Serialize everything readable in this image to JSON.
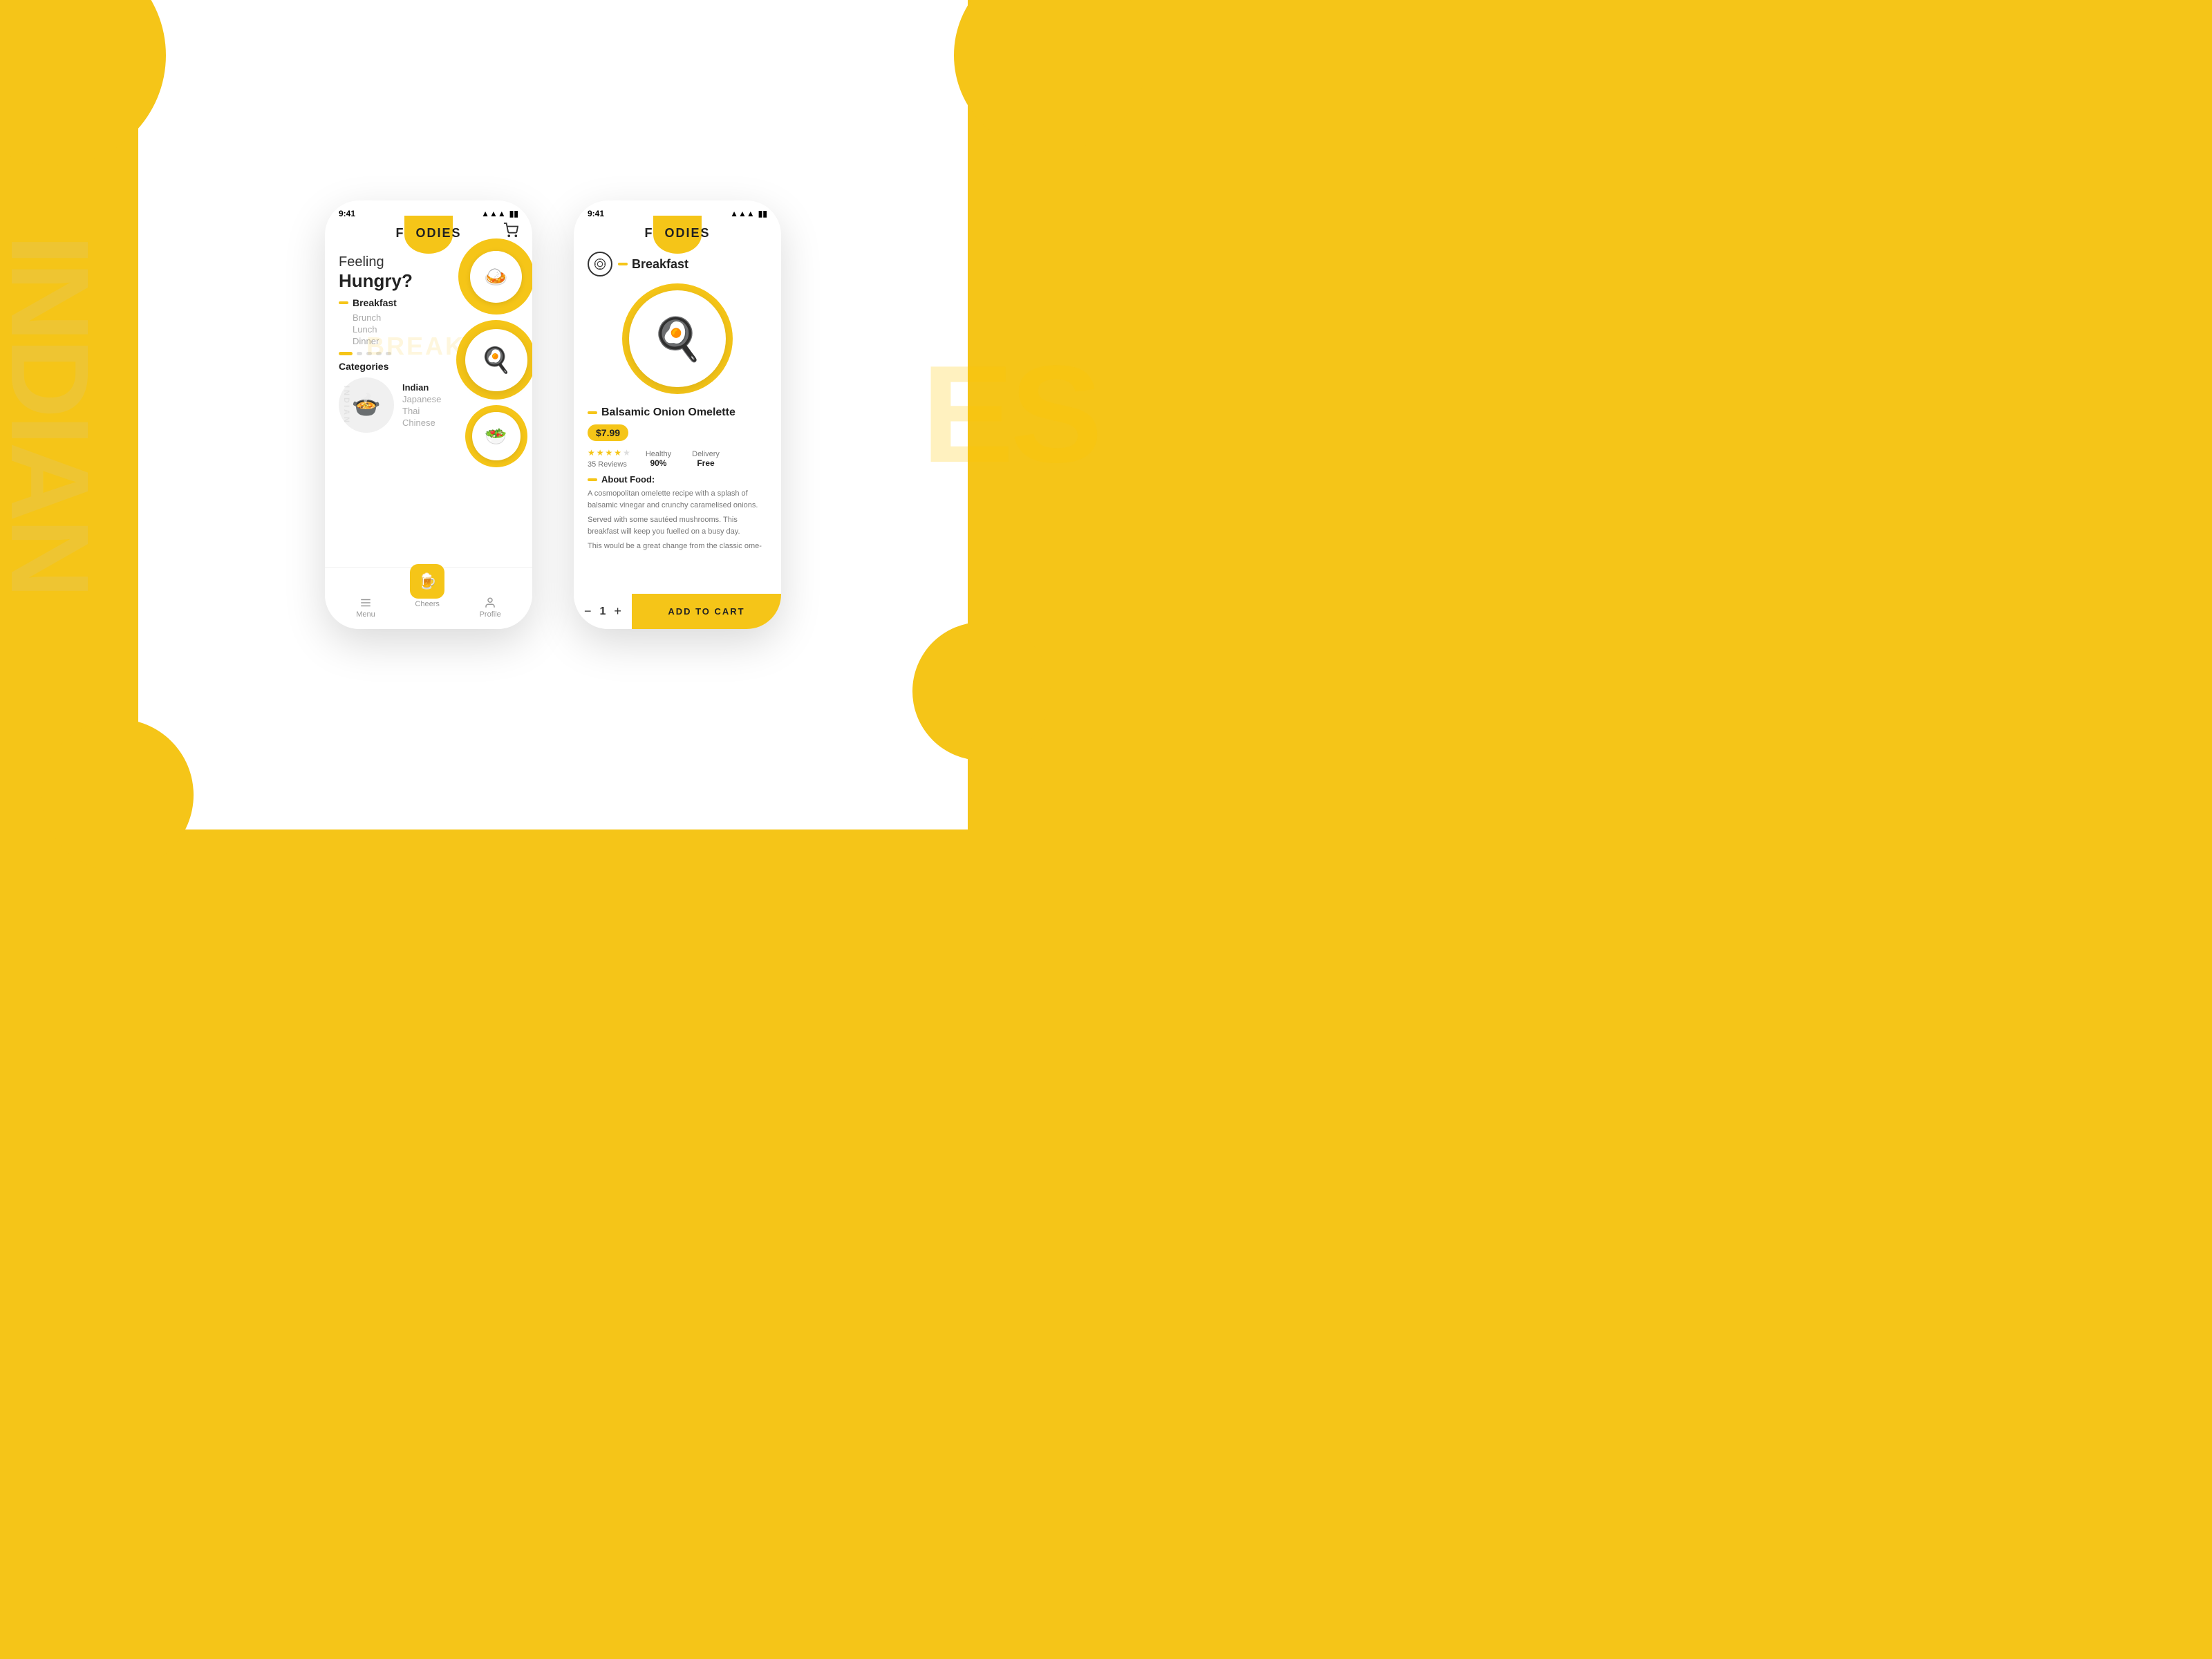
{
  "app": {
    "name": "FOODIES",
    "highlight_letter": "O",
    "time": "9:41",
    "accent_color": "#F5C518"
  },
  "background": {
    "text_left_vertical": "INDIAN",
    "text_right": "ES",
    "watermark_text": "BREAK"
  },
  "phone1": {
    "status": {
      "time": "9:41",
      "signal": "📶",
      "battery": "🔋"
    },
    "hero": {
      "line1": "Feeling",
      "line2": "Hungry?"
    },
    "categories": {
      "active": "Breakfast",
      "inactive": [
        "Brunch",
        "Lunch",
        "Dinner"
      ]
    },
    "carousel_dots": 5,
    "categories_section_title": "Categories",
    "cuisines": {
      "active": "Indian",
      "inactive": [
        "Japanese",
        "Thai",
        "Chinese"
      ]
    },
    "nav": {
      "menu_label": "Menu",
      "active_label": "Cheers",
      "profile_label": "Profile"
    },
    "food_images": [
      "🍳",
      "🍛",
      "🥗"
    ]
  },
  "phone2": {
    "status": {
      "time": "9:41",
      "signal": "📶",
      "battery": "🔋"
    },
    "section": "Breakfast",
    "product": {
      "name": "Balsamic Onion Omelette",
      "price": "$7.99",
      "rating": 4,
      "review_count": "35 Reviews",
      "healthy": {
        "label": "Healthy",
        "value": "90%"
      },
      "delivery": {
        "label": "Delivery",
        "value": "Free"
      }
    },
    "about": {
      "title": "About Food:",
      "paragraphs": [
        "A cosmopolitan omelette recipe with a splash of balsamic vinegar and crunchy caramelised onions.",
        "Served with some sautéed mushrooms. This breakfast will keep you fuelled on a busy day.",
        "This would be a great change from the classic ome-"
      ]
    },
    "cart": {
      "quantity": "1",
      "button_label": "ADD TO CART",
      "minus": "−",
      "plus": "+"
    }
  }
}
